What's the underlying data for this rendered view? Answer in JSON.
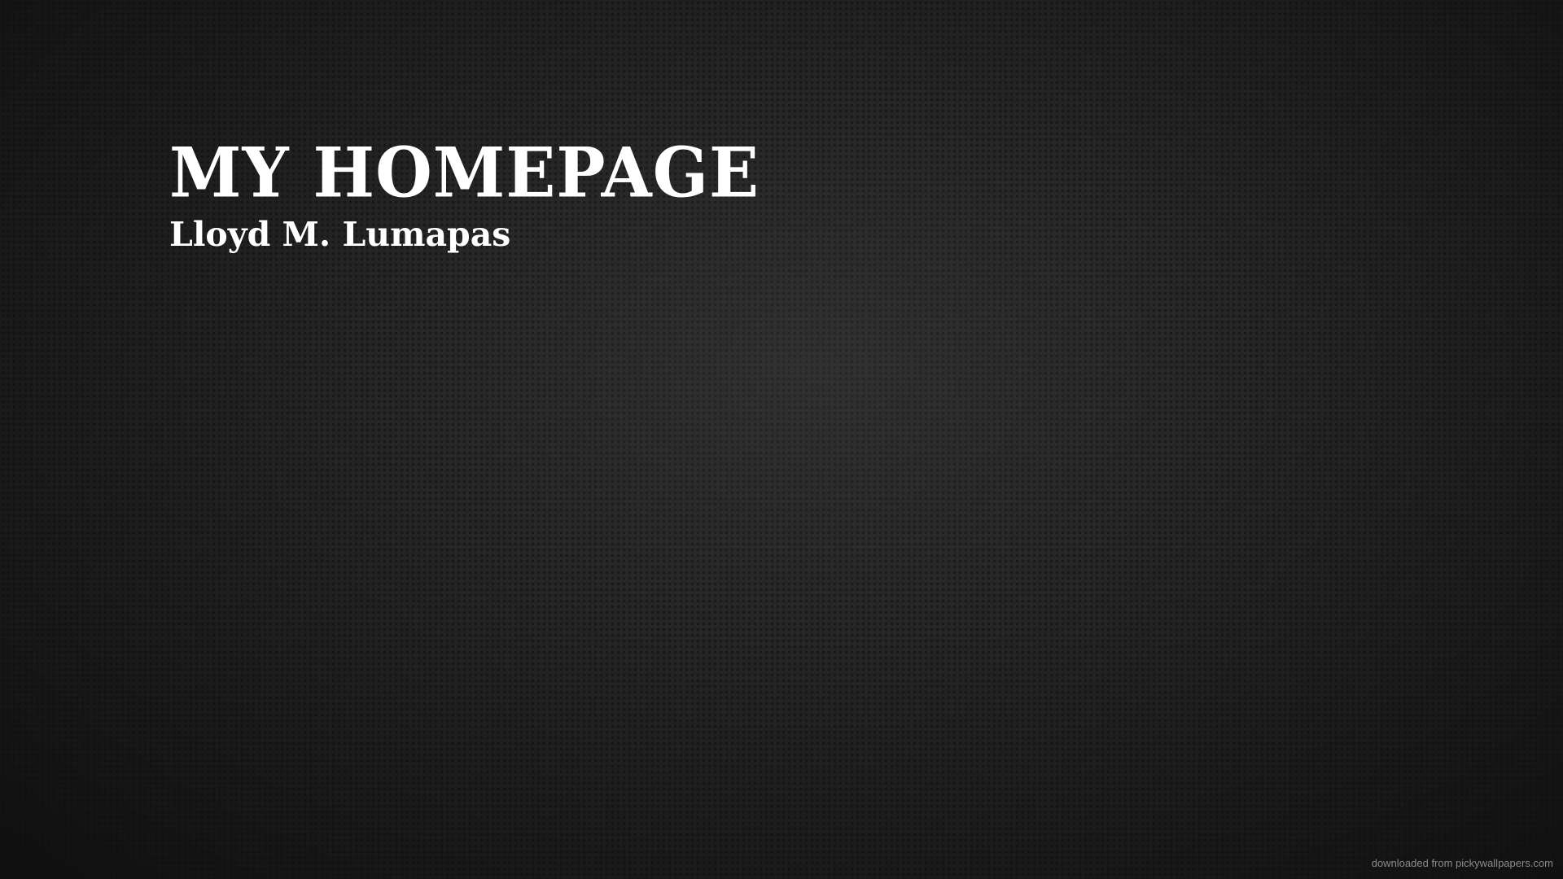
{
  "header": {
    "title": "MY HOMEPAGE",
    "subtitle": "Lloyd M. Lumapas"
  },
  "footer": {
    "credit": "downloaded from pickywallpapers.com"
  },
  "colors": {
    "background": "#262626",
    "text": "#ffffff",
    "credit_text": "#8a8a8a"
  }
}
